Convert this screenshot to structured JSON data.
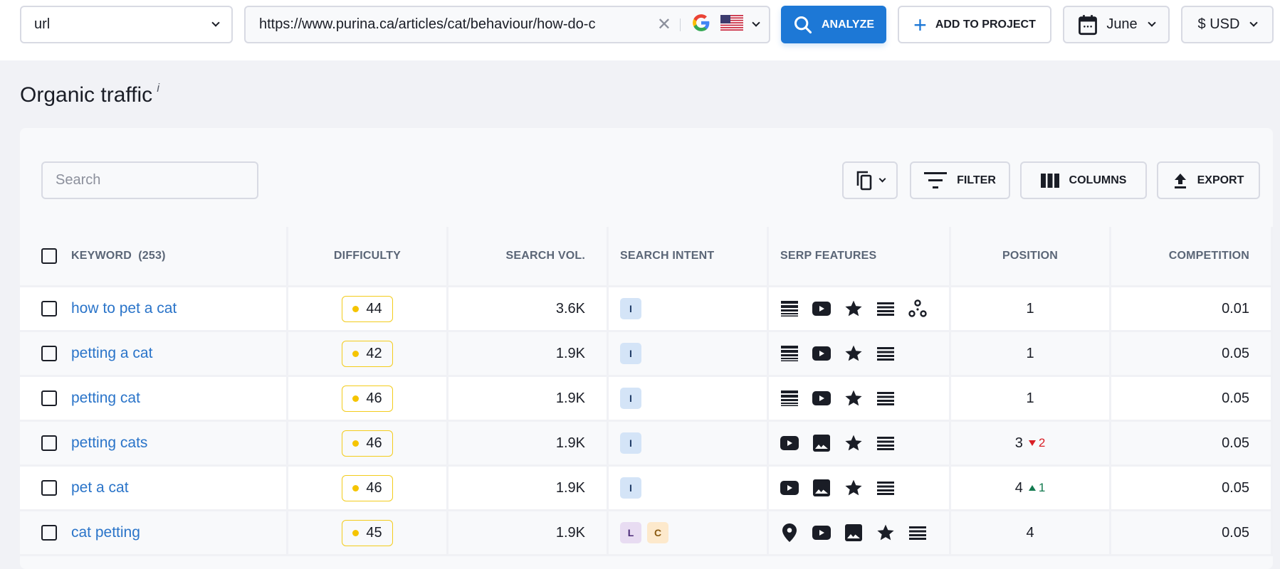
{
  "topbar": {
    "url_type": "url",
    "url_value": "https://www.purina.ca/articles/cat/behaviour/how-do-c",
    "search_engine": "google",
    "country_flag": "us",
    "analyze_label": "ANALYZE",
    "add_to_project_label": "ADD TO PROJECT",
    "month": "June",
    "currency": "$ USD"
  },
  "page": {
    "title": "Organic traffic",
    "title_info": "i"
  },
  "toolbar": {
    "search_placeholder": "Search",
    "search_value": "",
    "filter_label": "FILTER",
    "columns_label": "COLUMNS",
    "export_label": "EXPORT"
  },
  "table": {
    "headers": {
      "keyword": "KEYWORD",
      "keyword_count": "(253)",
      "difficulty": "DIFFICULTY",
      "search_vol": "SEARCH VOL.",
      "search_intent": "SEARCH INTENT",
      "serp_features": "SERP FEATURES",
      "position": "POSITION",
      "competition": "COMPETITION"
    },
    "rows": [
      {
        "keyword": "how to pet a cat",
        "difficulty": "44",
        "volume": "3.6K",
        "intent": [
          "I"
        ],
        "serp": [
          "featured-snippet",
          "video",
          "reviews",
          "people-also-ask",
          "knowledge-graph"
        ],
        "position": "1",
        "delta": "",
        "delta_dir": "",
        "competition": "0.01"
      },
      {
        "keyword": "petting a cat",
        "difficulty": "42",
        "volume": "1.9K",
        "intent": [
          "I"
        ],
        "serp": [
          "featured-snippet",
          "video",
          "reviews",
          "people-also-ask"
        ],
        "position": "1",
        "delta": "",
        "delta_dir": "",
        "competition": "0.05"
      },
      {
        "keyword": "petting cat",
        "difficulty": "46",
        "volume": "1.9K",
        "intent": [
          "I"
        ],
        "serp": [
          "featured-snippet",
          "video",
          "reviews",
          "people-also-ask"
        ],
        "position": "1",
        "delta": "",
        "delta_dir": "",
        "competition": "0.05"
      },
      {
        "keyword": "petting cats",
        "difficulty": "46",
        "volume": "1.9K",
        "intent": [
          "I"
        ],
        "serp": [
          "video",
          "images",
          "reviews",
          "people-also-ask"
        ],
        "position": "3",
        "delta": "2",
        "delta_dir": "down",
        "competition": "0.05"
      },
      {
        "keyword": "pet a cat",
        "difficulty": "46",
        "volume": "1.9K",
        "intent": [
          "I"
        ],
        "serp": [
          "video",
          "images",
          "reviews",
          "people-also-ask"
        ],
        "position": "4",
        "delta": "1",
        "delta_dir": "up",
        "competition": "0.05"
      },
      {
        "keyword": "cat petting",
        "difficulty": "45",
        "volume": "1.9K",
        "intent": [
          "L",
          "C"
        ],
        "serp": [
          "local-pack",
          "video",
          "images",
          "reviews",
          "people-also-ask"
        ],
        "position": "4",
        "delta": "",
        "delta_dir": "",
        "competition": "0.05"
      }
    ]
  },
  "colors": {
    "accent": "#1d78d6",
    "link": "#2a74c9",
    "difficulty_dot": "#f5c400",
    "difficulty_border": "#f3cc1c",
    "intent_I_bg": "#d4e4f7",
    "intent_I_fg": "#1f3b66",
    "intent_L_bg": "#e8dcf2",
    "intent_L_fg": "#4b2a78",
    "intent_C_bg": "#fde9cc",
    "intent_C_fg": "#8a5a10",
    "delta_down": "#d91f26",
    "delta_up": "#137a4f"
  }
}
